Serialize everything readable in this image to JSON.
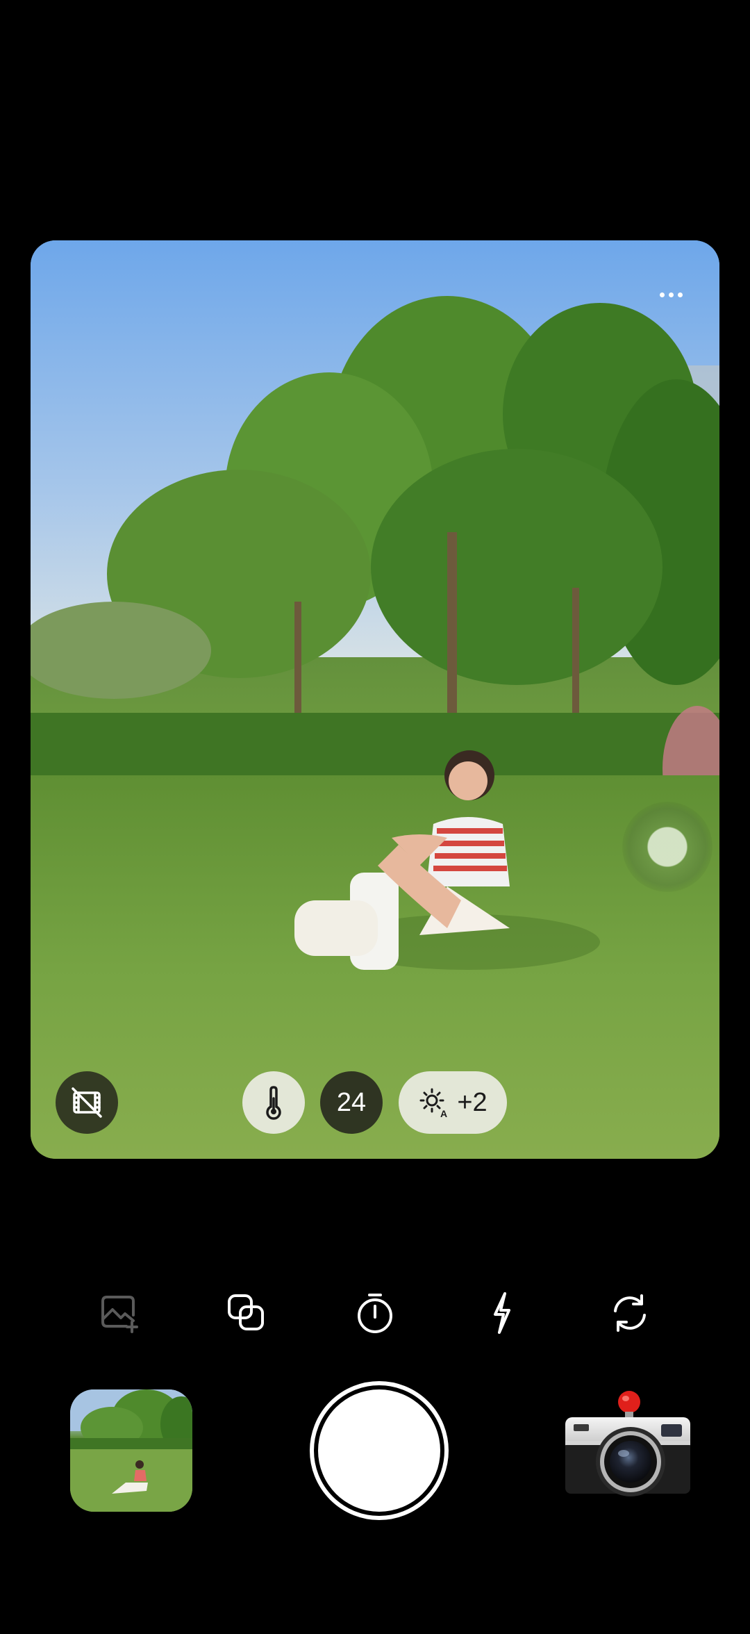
{
  "viewfinder": {
    "more_menu_icon": "ellipsis-icon"
  },
  "controls": {
    "film_icon": "film-off-icon",
    "temperature_icon": "thermometer-icon",
    "iso_value": "24",
    "exposure_icon": "auto-brightness-icon",
    "exposure_value": "+2"
  },
  "toolbar": {
    "items": [
      {
        "icon": "add-image-icon",
        "enabled": false
      },
      {
        "icon": "overlap-squares-icon",
        "enabled": true
      },
      {
        "icon": "timer-icon",
        "enabled": true
      },
      {
        "icon": "flash-icon",
        "enabled": true
      },
      {
        "icon": "switch-camera-icon",
        "enabled": true
      }
    ]
  },
  "bottom": {
    "gallery_thumbnail": "last-photo-thumbnail",
    "shutter": "shutter-button",
    "camera_style": "retro-camera-icon"
  },
  "colors": {
    "background": "#000000",
    "accent_red": "#e0201b",
    "dark_pill": "#28291e",
    "light_pill": "#ebece2"
  }
}
